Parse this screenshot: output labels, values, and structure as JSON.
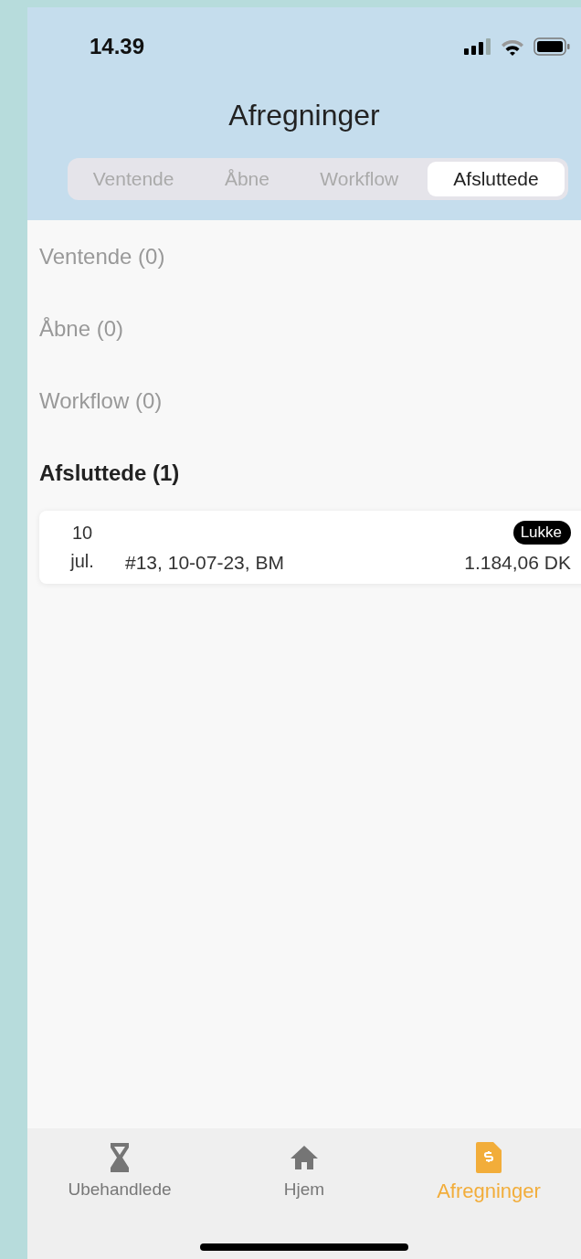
{
  "status_bar": {
    "time": "14.39"
  },
  "header": {
    "title": "Afregninger"
  },
  "tabs": [
    {
      "label": "Ventende",
      "selected": false
    },
    {
      "label": "Åbne",
      "selected": false
    },
    {
      "label": "Workflow",
      "selected": false
    },
    {
      "label": "Afsluttede",
      "selected": true
    }
  ],
  "sections": [
    {
      "heading": "Ventende (0)",
      "selected": false
    },
    {
      "heading": "Åbne (0)",
      "selected": false
    },
    {
      "heading": "Workflow (0)",
      "selected": false
    },
    {
      "heading": "Afsluttede (1)",
      "selected": true,
      "items": [
        {
          "day": "10",
          "month": "jul.",
          "description": "#13, 10-07-23, BM",
          "status": "Lukke",
          "amount": "1.184,06 DK"
        }
      ]
    }
  ],
  "bottom_nav": [
    {
      "label": "Ubehandlede",
      "kind": "hourglass",
      "selected": false
    },
    {
      "label": "Hjem",
      "kind": "home",
      "selected": false
    },
    {
      "label": "Afregninger",
      "kind": "invoice",
      "selected": true
    }
  ]
}
